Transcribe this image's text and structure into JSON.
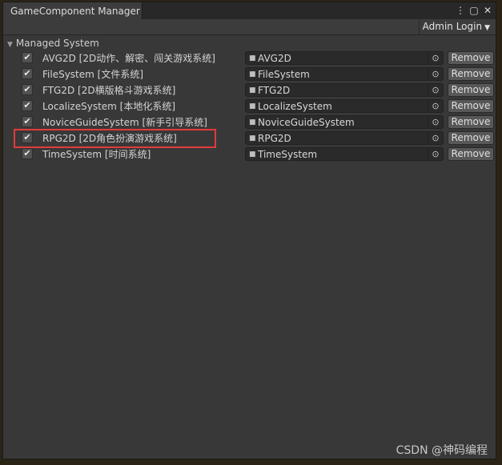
{
  "window": {
    "tab_title": "GameComponent Manager",
    "icons": [
      "more-icon",
      "maximize-icon",
      "close-icon"
    ]
  },
  "toolbar": {
    "admin_label": "Admin Login"
  },
  "section": {
    "title": "Managed System"
  },
  "systems": [
    {
      "label": "AVG2D [2D动作、解密、闯关游戏系统]",
      "field": "AVG2D",
      "checked": true
    },
    {
      "label": "FileSystem [文件系统]",
      "field": "FileSystem",
      "checked": true
    },
    {
      "label": "FTG2D [2D横版格斗游戏系统]",
      "field": "FTG2D",
      "checked": true
    },
    {
      "label": "LocalizeSystem [本地化系统]",
      "field": "LocalizeSystem",
      "checked": true
    },
    {
      "label": "NoviceGuideSystem [新手引导系统]",
      "field": "NoviceGuideSystem",
      "checked": true
    },
    {
      "label": "RPG2D [2D角色扮演游戏系统]",
      "field": "RPG2D",
      "checked": true
    },
    {
      "label": "TimeSystem [时间系统]",
      "field": "TimeSystem",
      "checked": true
    }
  ],
  "remove_label": "Remove",
  "highlighted_row": "RPG2D",
  "watermark": "CSDN @神码编程",
  "colors": {
    "highlight": "#e23b3b",
    "panel": "#383838"
  }
}
